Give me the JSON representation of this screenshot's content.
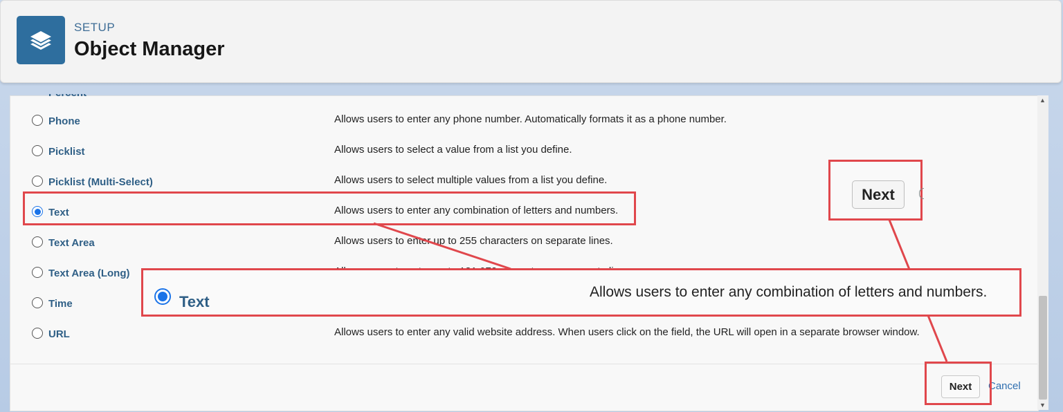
{
  "header": {
    "setup_label": "SETUP",
    "title": "Object Manager",
    "app_icon": "layers-icon"
  },
  "field_types": {
    "cut_off_label": "Percent",
    "rows": [
      {
        "label": "Phone",
        "description": "Allows users to enter any phone number. Automatically formats it as a phone number.",
        "selected": false
      },
      {
        "label": "Picklist",
        "description": "Allows users to select a value from a list you define.",
        "selected": false
      },
      {
        "label": "Picklist (Multi-Select)",
        "description": "Allows users to select multiple values from a list you define.",
        "selected": false
      },
      {
        "label": "Text",
        "description": "Allows users to enter any combination of letters and numbers.",
        "selected": true
      },
      {
        "label": "Text Area",
        "description": "Allows users to enter up to 255 characters on separate lines.",
        "selected": false
      },
      {
        "label": "Text Area (Long)",
        "description": "Allows users to enter up to 131,072 characters on separate lines.",
        "selected": false
      },
      {
        "label": "Time",
        "description": "",
        "selected": false
      },
      {
        "label": "URL",
        "description": "Allows users to enter any valid website address. When users click on the field, the URL will open in a separate browser window.",
        "selected": false
      }
    ]
  },
  "footer": {
    "next_label": "Next",
    "cancel_label": "Cancel"
  },
  "callouts": {
    "zoom_text_label": "Text",
    "zoom_text_description": "Allows users to enter any combination of letters and numbers.",
    "zoom_next_label": "Next",
    "highlight_color": "#e0474c"
  }
}
